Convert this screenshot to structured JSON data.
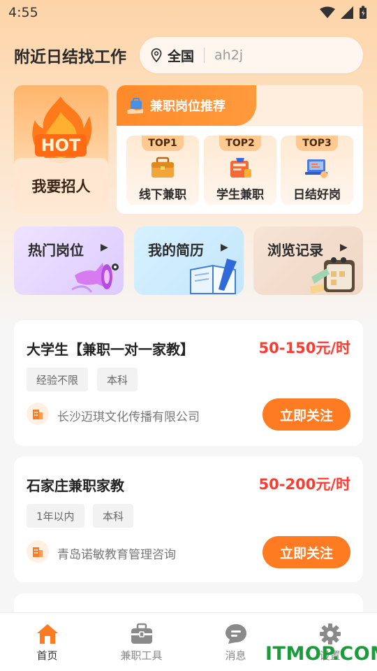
{
  "status_bar": {
    "time": "4:55"
  },
  "header": {
    "title": "附近日结找工作",
    "location": "全国",
    "search_value": "ah2j"
  },
  "hot_card": {
    "badge": "HOT",
    "label": "我要招人"
  },
  "recommend": {
    "title": "兼职岗位推荐",
    "items": [
      {
        "rank": "TOP1",
        "label": "线下兼职",
        "icon": "briefcase-icon"
      },
      {
        "rank": "TOP2",
        "label": "学生兼职",
        "icon": "student-icon"
      },
      {
        "rank": "TOP3",
        "label": "日结好岗",
        "icon": "laptop-icon"
      }
    ]
  },
  "quick_links": [
    {
      "label": "热门岗位",
      "icon": "megaphone-icon"
    },
    {
      "label": "我的简历",
      "icon": "book-icon"
    },
    {
      "label": "浏览记录",
      "icon": "notebook-icon"
    }
  ],
  "jobs": [
    {
      "title": "大学生【兼职一对一家教】",
      "salary": "50-150元/时",
      "tags": [
        "经验不限",
        "本科"
      ],
      "company": "长沙迈琪文化传播有限公司",
      "action": "立即关注"
    },
    {
      "title": "石家庄兼职家教",
      "salary": "50-200元/时",
      "tags": [
        "1年以内",
        "本科"
      ],
      "company": "青岛诺敏教育管理咨询",
      "action": "立即关注"
    }
  ],
  "tab_bar": [
    {
      "label": "首页",
      "icon": "home-icon",
      "active": true
    },
    {
      "label": "兼职工具",
      "icon": "toolbox-icon"
    },
    {
      "label": "消息",
      "icon": "message-icon"
    },
    {
      "label": "设置",
      "icon": "gear-icon"
    }
  ],
  "watermark": "ITMOP.COM",
  "colors": {
    "accent": "#ff7b22",
    "salary": "#ff3b2f",
    "home_tab": "#ff7b22"
  }
}
